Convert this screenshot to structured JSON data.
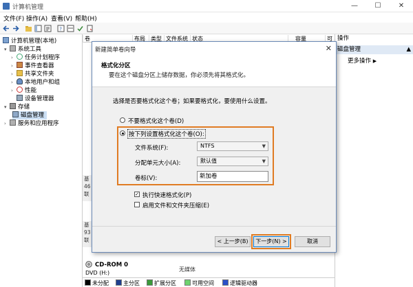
{
  "window": {
    "title": "计算机管理",
    "minimize": "—",
    "maximize": "☐",
    "close": "✕"
  },
  "menu": [
    "文件(F)",
    "操作(A)",
    "查看(V)",
    "帮助(H)"
  ],
  "tree": {
    "root": "计算机管理(本地)",
    "system_tools": "系统工具",
    "task_scheduler": "任务计划程序",
    "event_viewer": "事件查看器",
    "shared_folders": "共享文件夹",
    "local_users": "本地用户和组",
    "performance": "性能",
    "device_manager": "设备管理器",
    "storage": "存储",
    "disk_management": "磁盘管理",
    "services": "服务和应用程序"
  },
  "columns": [
    "卷",
    "布局",
    "类型",
    "文件系统",
    "状态",
    "容量",
    "可"
  ],
  "actions": {
    "header": "操作",
    "selected": "磁盘管理",
    "more": "更多操作"
  },
  "disk_strips": [
    {
      "lines": [
        "基",
        "46",
        "联"
      ]
    },
    {
      "lines": [
        "基",
        "93",
        "联"
      ]
    }
  ],
  "cdrom": {
    "name": "CD-ROM 0",
    "type": "DVD (H:)",
    "status": "无媒体"
  },
  "legend": [
    {
      "label": "未分配",
      "color": "#000000"
    },
    {
      "label": "主分区",
      "color": "#1f3f8f"
    },
    {
      "label": "扩展分区",
      "color": "#3a9a3a"
    },
    {
      "label": "可用空间",
      "color": "#6fd36f"
    },
    {
      "label": "逻辑驱动器",
      "color": "#2a50c8"
    }
  ],
  "dialog": {
    "title": "新建简单卷向导",
    "close": "✕",
    "heading": "格式化分区",
    "subheading": "要在这个磁盘分区上储存数据，你必须先将其格式化。",
    "prompt": "选择是否要格式化这个卷；如果要格式化，要使用什么设置。",
    "option_no_format": "不要格式化这个卷(D)",
    "option_format": "按下列设置格式化这个卷(O):",
    "fs_label": "文件系统(F):",
    "fs_value": "NTFS",
    "alloc_label": "分配单元大小(A):",
    "alloc_value": "默认值",
    "volume_label": "卷标(V):",
    "volume_value": "新加卷",
    "quick_format": "执行快速格式化(P)",
    "compression": "启用文件和文件夹压缩(E)",
    "back": "< 上一步(B)",
    "next": "下一步(N) >",
    "cancel": "取消"
  },
  "colors": {
    "highlight": "#e07b22",
    "selection": "#dfe9f5"
  }
}
